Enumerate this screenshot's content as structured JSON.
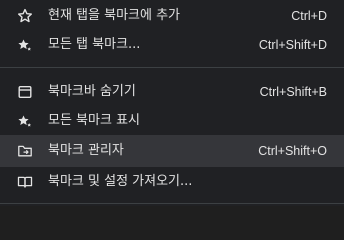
{
  "menu": {
    "items": [
      {
        "icon": "star-outline-icon",
        "label": "현재 탭을 북마크에 추가",
        "shortcut": "Ctrl+D"
      },
      {
        "icon": "stars-icon",
        "label": "모든 탭 북마크...",
        "shortcut": "Ctrl+Shift+D"
      },
      {
        "icon": "bookmark-bar-icon",
        "label": "북마크바 숨기기",
        "shortcut": "Ctrl+Shift+B"
      },
      {
        "icon": "stars-icon",
        "label": "모든 북마크 표시",
        "shortcut": ""
      },
      {
        "icon": "folder-arrow-icon",
        "label": "북마크 관리자",
        "shortcut": "Ctrl+Shift+O"
      },
      {
        "icon": "import-book-icon",
        "label": "북마크 및 설정 가져오기...",
        "shortcut": ""
      }
    ],
    "hovered_index": 4
  }
}
